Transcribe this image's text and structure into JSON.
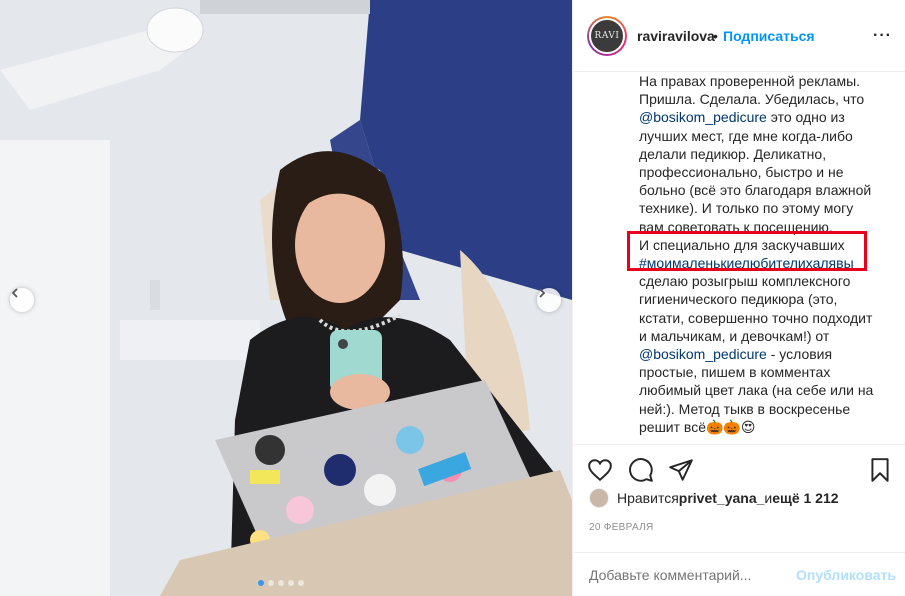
{
  "post": {
    "username": "raviravilova",
    "separator": "•",
    "follow_label": "Подписаться",
    "more_label": "···",
    "avatar_text": "RAVI"
  },
  "caption": {
    "lines": [
      "На правах проверенной рекламы.",
      "Пришла. Сделала. Убедилась, что",
      "@bosikom_pedicure это одно из",
      "лучших мест, где мне когда-либо",
      "делали педикюр. Деликатно,",
      "профессионально, быстро и не",
      "больно (всё это благодаря влажной",
      "технике). И только по этому могу",
      "вам советовать к посещению.",
      "И специально для заскучавших",
      "#моималенькиелюбителихалявы",
      "сделаю розыгрыш комплексного",
      "гигиенического педикюра (это,",
      "кстати, совершенно точно подходит",
      "и мальчикам, и девочкам!) от",
      "@bosikom_pedicure - условия",
      "простые, пишем в комментах",
      "любимый цвет лака (на себе или на",
      "ней:). Метод тыкв в воскресенье",
      "решит всё🎃🎃😍",
      "•"
    ],
    "mention": "@bosikom_pedicure",
    "line3_rest": " это одно из",
    "hashtag": "#моималенькиелюбителихалявы",
    "line16_rest": " - условия"
  },
  "likes": {
    "prefix": "Нравится ",
    "user": "privet_yana_",
    "middle": " и ",
    "count": "ещё 1 212"
  },
  "date": "20 ФЕВРАЛЯ",
  "comment": {
    "placeholder": "Добавьте комментарий...",
    "publish_label": "Опубликовать"
  },
  "carousel": {
    "dot_count": 5,
    "active_index": 0
  },
  "colors": {
    "accent": "#0095f6",
    "highlight_box": "#e8001c",
    "link": "#00376b"
  },
  "icons": [
    "chevron-left-icon",
    "chevron-right-icon",
    "heart-icon",
    "comment-icon",
    "share-icon",
    "bookmark-icon",
    "more-icon"
  ]
}
